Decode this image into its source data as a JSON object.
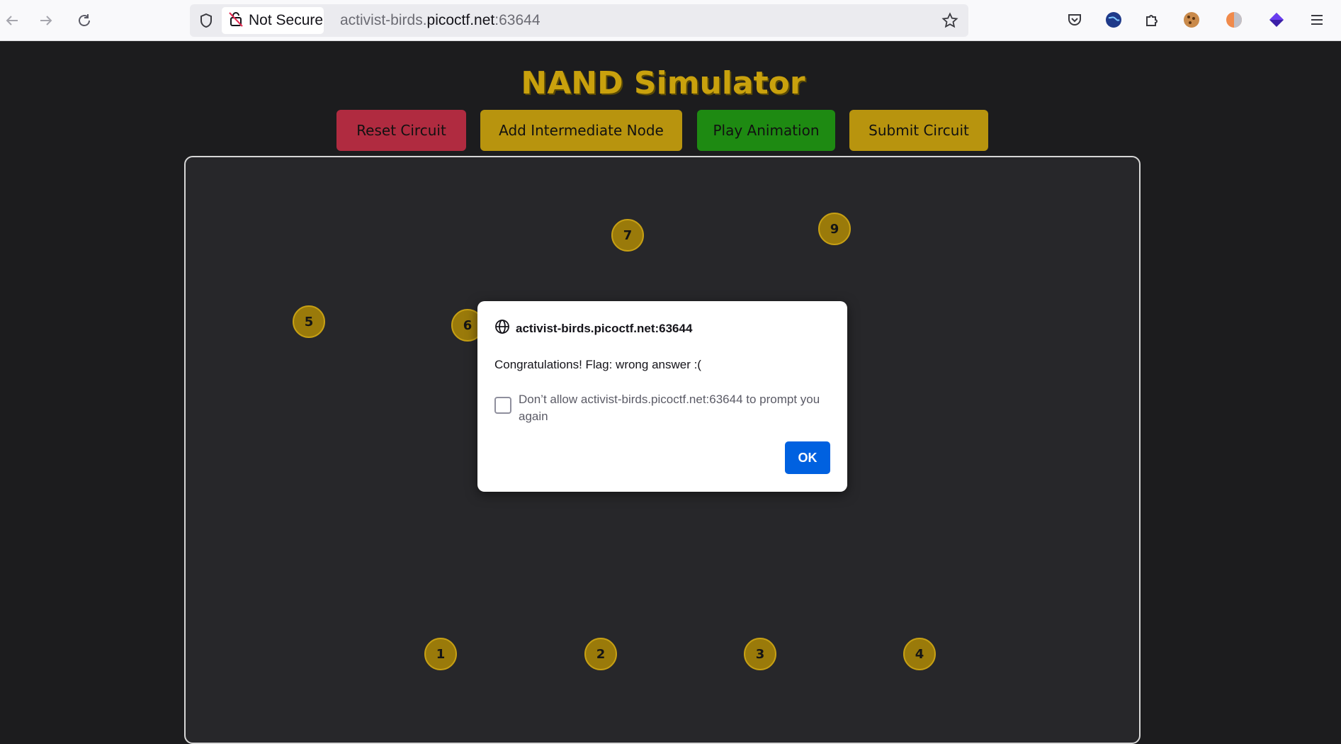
{
  "browser": {
    "security_label": "Not Secure",
    "url_prefix": "activist-birds.",
    "url_host": "picoctf.net",
    "url_suffix": ":63644"
  },
  "page": {
    "title": "NAND Simulator",
    "buttons": {
      "reset": "Reset Circuit",
      "add_node": "Add Intermediate Node",
      "play": "Play Animation",
      "submit": "Submit Circuit"
    },
    "nodes": [
      {
        "label": "1"
      },
      {
        "label": "2"
      },
      {
        "label": "3"
      },
      {
        "label": "4"
      },
      {
        "label": "5"
      },
      {
        "label": "6"
      },
      {
        "label": "7"
      },
      {
        "label": "9"
      }
    ]
  },
  "dialog": {
    "origin": "activist-birds.picoctf.net:63644",
    "message": "Congratulations! Flag: wrong answer :(",
    "checkbox_label": "Don’t allow activist-birds.picoctf.net:63644 to prompt you again",
    "ok_label": "OK"
  },
  "colors": {
    "background": "#1c1c1e",
    "accent_gold": "#c9a10d",
    "reset_red": "#b02b40",
    "play_green": "#1e8a12",
    "ok_blue": "#0061e0"
  }
}
